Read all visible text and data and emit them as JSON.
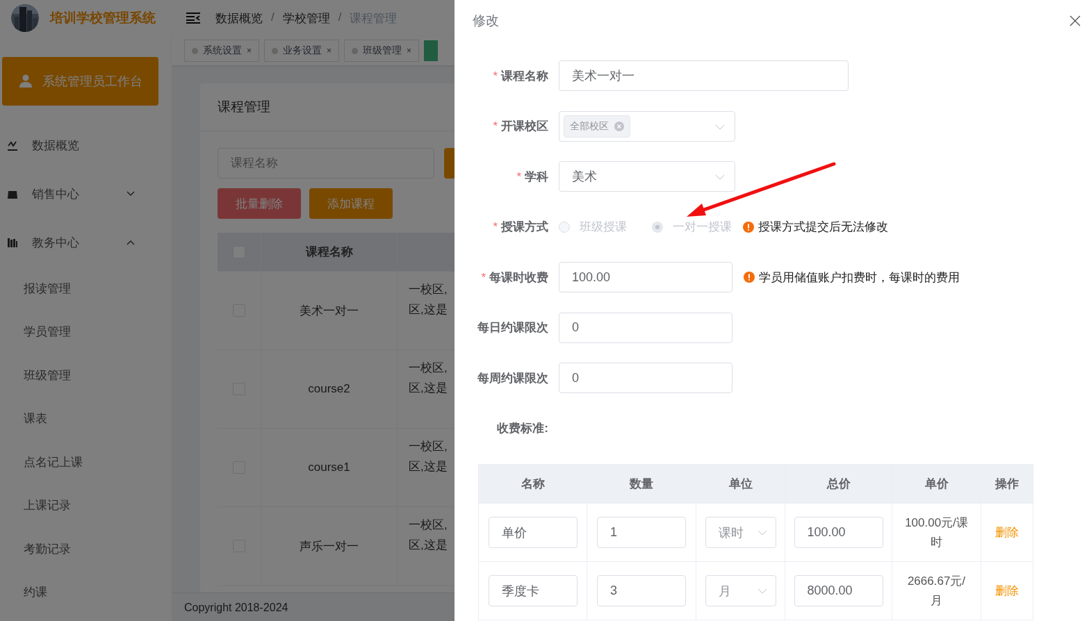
{
  "app": {
    "title": "培训学校管理系统"
  },
  "breadcrumb_separator": "/",
  "breadcrumb": [
    {
      "label": "数据概览",
      "current": false
    },
    {
      "label": "学校管理",
      "current": false
    },
    {
      "label": "课程管理",
      "current": true
    }
  ],
  "tabs": [
    {
      "label": "系统设置",
      "selected": false,
      "close": "×"
    },
    {
      "label": "业务设置",
      "selected": false,
      "close": "×"
    },
    {
      "label": "班级管理",
      "selected": false,
      "close": "×"
    }
  ],
  "sidebar": {
    "workbench": "系统管理员工作台",
    "items": [
      {
        "label": "数据概览",
        "kind": "link"
      },
      {
        "label": "销售中心",
        "kind": "group",
        "expanded": false
      },
      {
        "label": "教务中心",
        "kind": "group",
        "expanded": true,
        "children": [
          "报读管理",
          "学员管理",
          "班级管理",
          "课表",
          "点名记上课",
          "上课记录",
          "考勤记录",
          "约课"
        ]
      }
    ]
  },
  "page": {
    "title": "课程管理",
    "search": {
      "placeholder": "课程名称"
    },
    "buttons": [
      {
        "label": "批量删除",
        "kind": "danger"
      },
      {
        "label": "添加课程",
        "kind": "primary"
      }
    ],
    "table": {
      "header_checked": false,
      "columns": [
        "课程名称"
      ],
      "rows": [
        {
          "checked": false,
          "name": "美术一对一",
          "campus": [
            "一校区,",
            "区,这是"
          ]
        },
        {
          "checked": false,
          "name": "course2",
          "campus": [
            "一校区,",
            "区,这是"
          ]
        },
        {
          "checked": false,
          "name": "course1",
          "campus": [
            "一校区,",
            "区,这是"
          ]
        },
        {
          "checked": false,
          "name": "声乐一对一",
          "campus": [
            "一校区,",
            "区,这是"
          ]
        }
      ]
    },
    "footer": "Copyright 2018-2024"
  },
  "drawer": {
    "title": "修改",
    "fields": [
      {
        "label": "课程名称",
        "required_mark": "*",
        "kind": "text",
        "value": "美术一对一"
      },
      {
        "label": "开课校区",
        "required_mark": "*",
        "kind": "tags",
        "tags": [
          "全部校区"
        ]
      },
      {
        "label": "学科",
        "required_mark": "*",
        "kind": "select",
        "value": "美术"
      },
      {
        "label": "授课方式",
        "required_mark": "*",
        "kind": "radio",
        "options": [
          {
            "label": "班级授课",
            "selected": false,
            "disabled": true
          },
          {
            "label": "一对一授课",
            "selected": true,
            "disabled": true
          }
        ],
        "hint": "授课方式提交后无法修改"
      },
      {
        "label": "每课时收费",
        "required_mark": "*",
        "kind": "text",
        "value": "100.00",
        "hint": "学员用储值账户扣费时，每课时的费用"
      },
      {
        "label": "每日约课限次",
        "kind": "text",
        "value": "0"
      },
      {
        "label": "每周约课限次",
        "kind": "text",
        "value": "0"
      }
    ],
    "fees": {
      "label": "收费标准:",
      "columns": [
        "名称",
        "数量",
        "单位",
        "总价",
        "单价",
        "操作"
      ],
      "rows": [
        {
          "name": "单价",
          "quantity": "1",
          "unit": "课时",
          "total": "100.00",
          "unit_price": "100.00元/课时",
          "action": "删除"
        },
        {
          "name": "季度卡",
          "quantity": "3",
          "unit": "月",
          "total": "8000.00",
          "unit_price": "2666.67元/月",
          "action": "删除"
        }
      ]
    }
  }
}
